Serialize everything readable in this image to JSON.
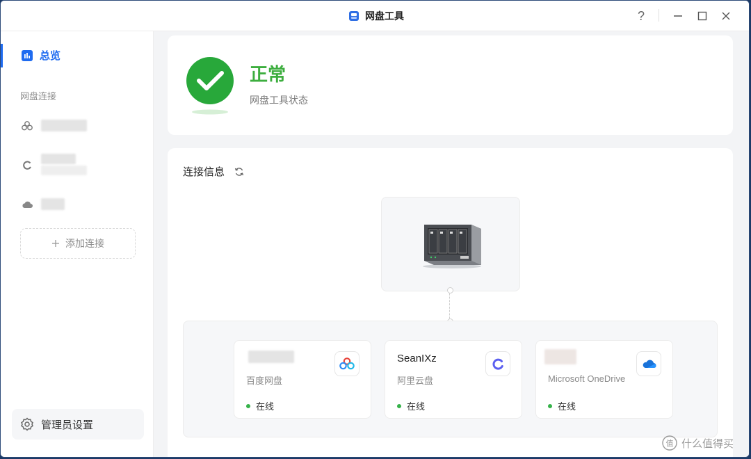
{
  "window": {
    "title": "网盘工具"
  },
  "titlebar": {
    "help_symbol": "?"
  },
  "sidebar": {
    "overview_label": "总览",
    "section_title": "网盘连接",
    "add_connection_label": "添加连接",
    "admin_settings_label": "管理员设置",
    "connections": [
      {
        "icon": "baidu-cloud-icon"
      },
      {
        "icon": "aliyun-drive-icon"
      },
      {
        "icon": "onedrive-cloud-icon"
      }
    ]
  },
  "status": {
    "title": "正常",
    "subtitle": "网盘工具状态"
  },
  "connections_panel": {
    "title": "连接信息",
    "clouds": [
      {
        "name": "",
        "service": "百度网盘",
        "status": "在线"
      },
      {
        "name": "SeanIXz",
        "service": "阿里云盘",
        "status": "在线"
      },
      {
        "name": "",
        "service": "Microsoft OneDrive",
        "status": "在线"
      }
    ]
  },
  "watermark": {
    "text": "什么值得买"
  },
  "colors": {
    "accent": "#1e6bf0",
    "ok": "#3dae3f",
    "online": "#36b24a"
  }
}
